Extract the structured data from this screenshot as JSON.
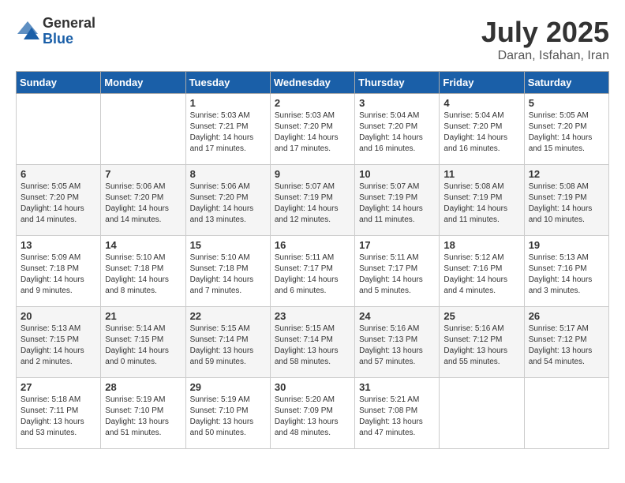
{
  "logo": {
    "general": "General",
    "blue": "Blue"
  },
  "title": {
    "month_year": "July 2025",
    "location": "Daran, Isfahan, Iran"
  },
  "days_of_week": [
    "Sunday",
    "Monday",
    "Tuesday",
    "Wednesday",
    "Thursday",
    "Friday",
    "Saturday"
  ],
  "weeks": [
    [
      {
        "day": "",
        "sunrise": "",
        "sunset": "",
        "daylight": ""
      },
      {
        "day": "",
        "sunrise": "",
        "sunset": "",
        "daylight": ""
      },
      {
        "day": "1",
        "sunrise": "Sunrise: 5:03 AM",
        "sunset": "Sunset: 7:21 PM",
        "daylight": "Daylight: 14 hours and 17 minutes."
      },
      {
        "day": "2",
        "sunrise": "Sunrise: 5:03 AM",
        "sunset": "Sunset: 7:20 PM",
        "daylight": "Daylight: 14 hours and 17 minutes."
      },
      {
        "day": "3",
        "sunrise": "Sunrise: 5:04 AM",
        "sunset": "Sunset: 7:20 PM",
        "daylight": "Daylight: 14 hours and 16 minutes."
      },
      {
        "day": "4",
        "sunrise": "Sunrise: 5:04 AM",
        "sunset": "Sunset: 7:20 PM",
        "daylight": "Daylight: 14 hours and 16 minutes."
      },
      {
        "day": "5",
        "sunrise": "Sunrise: 5:05 AM",
        "sunset": "Sunset: 7:20 PM",
        "daylight": "Daylight: 14 hours and 15 minutes."
      }
    ],
    [
      {
        "day": "6",
        "sunrise": "Sunrise: 5:05 AM",
        "sunset": "Sunset: 7:20 PM",
        "daylight": "Daylight: 14 hours and 14 minutes."
      },
      {
        "day": "7",
        "sunrise": "Sunrise: 5:06 AM",
        "sunset": "Sunset: 7:20 PM",
        "daylight": "Daylight: 14 hours and 14 minutes."
      },
      {
        "day": "8",
        "sunrise": "Sunrise: 5:06 AM",
        "sunset": "Sunset: 7:20 PM",
        "daylight": "Daylight: 14 hours and 13 minutes."
      },
      {
        "day": "9",
        "sunrise": "Sunrise: 5:07 AM",
        "sunset": "Sunset: 7:19 PM",
        "daylight": "Daylight: 14 hours and 12 minutes."
      },
      {
        "day": "10",
        "sunrise": "Sunrise: 5:07 AM",
        "sunset": "Sunset: 7:19 PM",
        "daylight": "Daylight: 14 hours and 11 minutes."
      },
      {
        "day": "11",
        "sunrise": "Sunrise: 5:08 AM",
        "sunset": "Sunset: 7:19 PM",
        "daylight": "Daylight: 14 hours and 11 minutes."
      },
      {
        "day": "12",
        "sunrise": "Sunrise: 5:08 AM",
        "sunset": "Sunset: 7:19 PM",
        "daylight": "Daylight: 14 hours and 10 minutes."
      }
    ],
    [
      {
        "day": "13",
        "sunrise": "Sunrise: 5:09 AM",
        "sunset": "Sunset: 7:18 PM",
        "daylight": "Daylight: 14 hours and 9 minutes."
      },
      {
        "day": "14",
        "sunrise": "Sunrise: 5:10 AM",
        "sunset": "Sunset: 7:18 PM",
        "daylight": "Daylight: 14 hours and 8 minutes."
      },
      {
        "day": "15",
        "sunrise": "Sunrise: 5:10 AM",
        "sunset": "Sunset: 7:18 PM",
        "daylight": "Daylight: 14 hours and 7 minutes."
      },
      {
        "day": "16",
        "sunrise": "Sunrise: 5:11 AM",
        "sunset": "Sunset: 7:17 PM",
        "daylight": "Daylight: 14 hours and 6 minutes."
      },
      {
        "day": "17",
        "sunrise": "Sunrise: 5:11 AM",
        "sunset": "Sunset: 7:17 PM",
        "daylight": "Daylight: 14 hours and 5 minutes."
      },
      {
        "day": "18",
        "sunrise": "Sunrise: 5:12 AM",
        "sunset": "Sunset: 7:16 PM",
        "daylight": "Daylight: 14 hours and 4 minutes."
      },
      {
        "day": "19",
        "sunrise": "Sunrise: 5:13 AM",
        "sunset": "Sunset: 7:16 PM",
        "daylight": "Daylight: 14 hours and 3 minutes."
      }
    ],
    [
      {
        "day": "20",
        "sunrise": "Sunrise: 5:13 AM",
        "sunset": "Sunset: 7:15 PM",
        "daylight": "Daylight: 14 hours and 2 minutes."
      },
      {
        "day": "21",
        "sunrise": "Sunrise: 5:14 AM",
        "sunset": "Sunset: 7:15 PM",
        "daylight": "Daylight: 14 hours and 0 minutes."
      },
      {
        "day": "22",
        "sunrise": "Sunrise: 5:15 AM",
        "sunset": "Sunset: 7:14 PM",
        "daylight": "Daylight: 13 hours and 59 minutes."
      },
      {
        "day": "23",
        "sunrise": "Sunrise: 5:15 AM",
        "sunset": "Sunset: 7:14 PM",
        "daylight": "Daylight: 13 hours and 58 minutes."
      },
      {
        "day": "24",
        "sunrise": "Sunrise: 5:16 AM",
        "sunset": "Sunset: 7:13 PM",
        "daylight": "Daylight: 13 hours and 57 minutes."
      },
      {
        "day": "25",
        "sunrise": "Sunrise: 5:16 AM",
        "sunset": "Sunset: 7:12 PM",
        "daylight": "Daylight: 13 hours and 55 minutes."
      },
      {
        "day": "26",
        "sunrise": "Sunrise: 5:17 AM",
        "sunset": "Sunset: 7:12 PM",
        "daylight": "Daylight: 13 hours and 54 minutes."
      }
    ],
    [
      {
        "day": "27",
        "sunrise": "Sunrise: 5:18 AM",
        "sunset": "Sunset: 7:11 PM",
        "daylight": "Daylight: 13 hours and 53 minutes."
      },
      {
        "day": "28",
        "sunrise": "Sunrise: 5:19 AM",
        "sunset": "Sunset: 7:10 PM",
        "daylight": "Daylight: 13 hours and 51 minutes."
      },
      {
        "day": "29",
        "sunrise": "Sunrise: 5:19 AM",
        "sunset": "Sunset: 7:10 PM",
        "daylight": "Daylight: 13 hours and 50 minutes."
      },
      {
        "day": "30",
        "sunrise": "Sunrise: 5:20 AM",
        "sunset": "Sunset: 7:09 PM",
        "daylight": "Daylight: 13 hours and 48 minutes."
      },
      {
        "day": "31",
        "sunrise": "Sunrise: 5:21 AM",
        "sunset": "Sunset: 7:08 PM",
        "daylight": "Daylight: 13 hours and 47 minutes."
      },
      {
        "day": "",
        "sunrise": "",
        "sunset": "",
        "daylight": ""
      },
      {
        "day": "",
        "sunrise": "",
        "sunset": "",
        "daylight": ""
      }
    ]
  ]
}
